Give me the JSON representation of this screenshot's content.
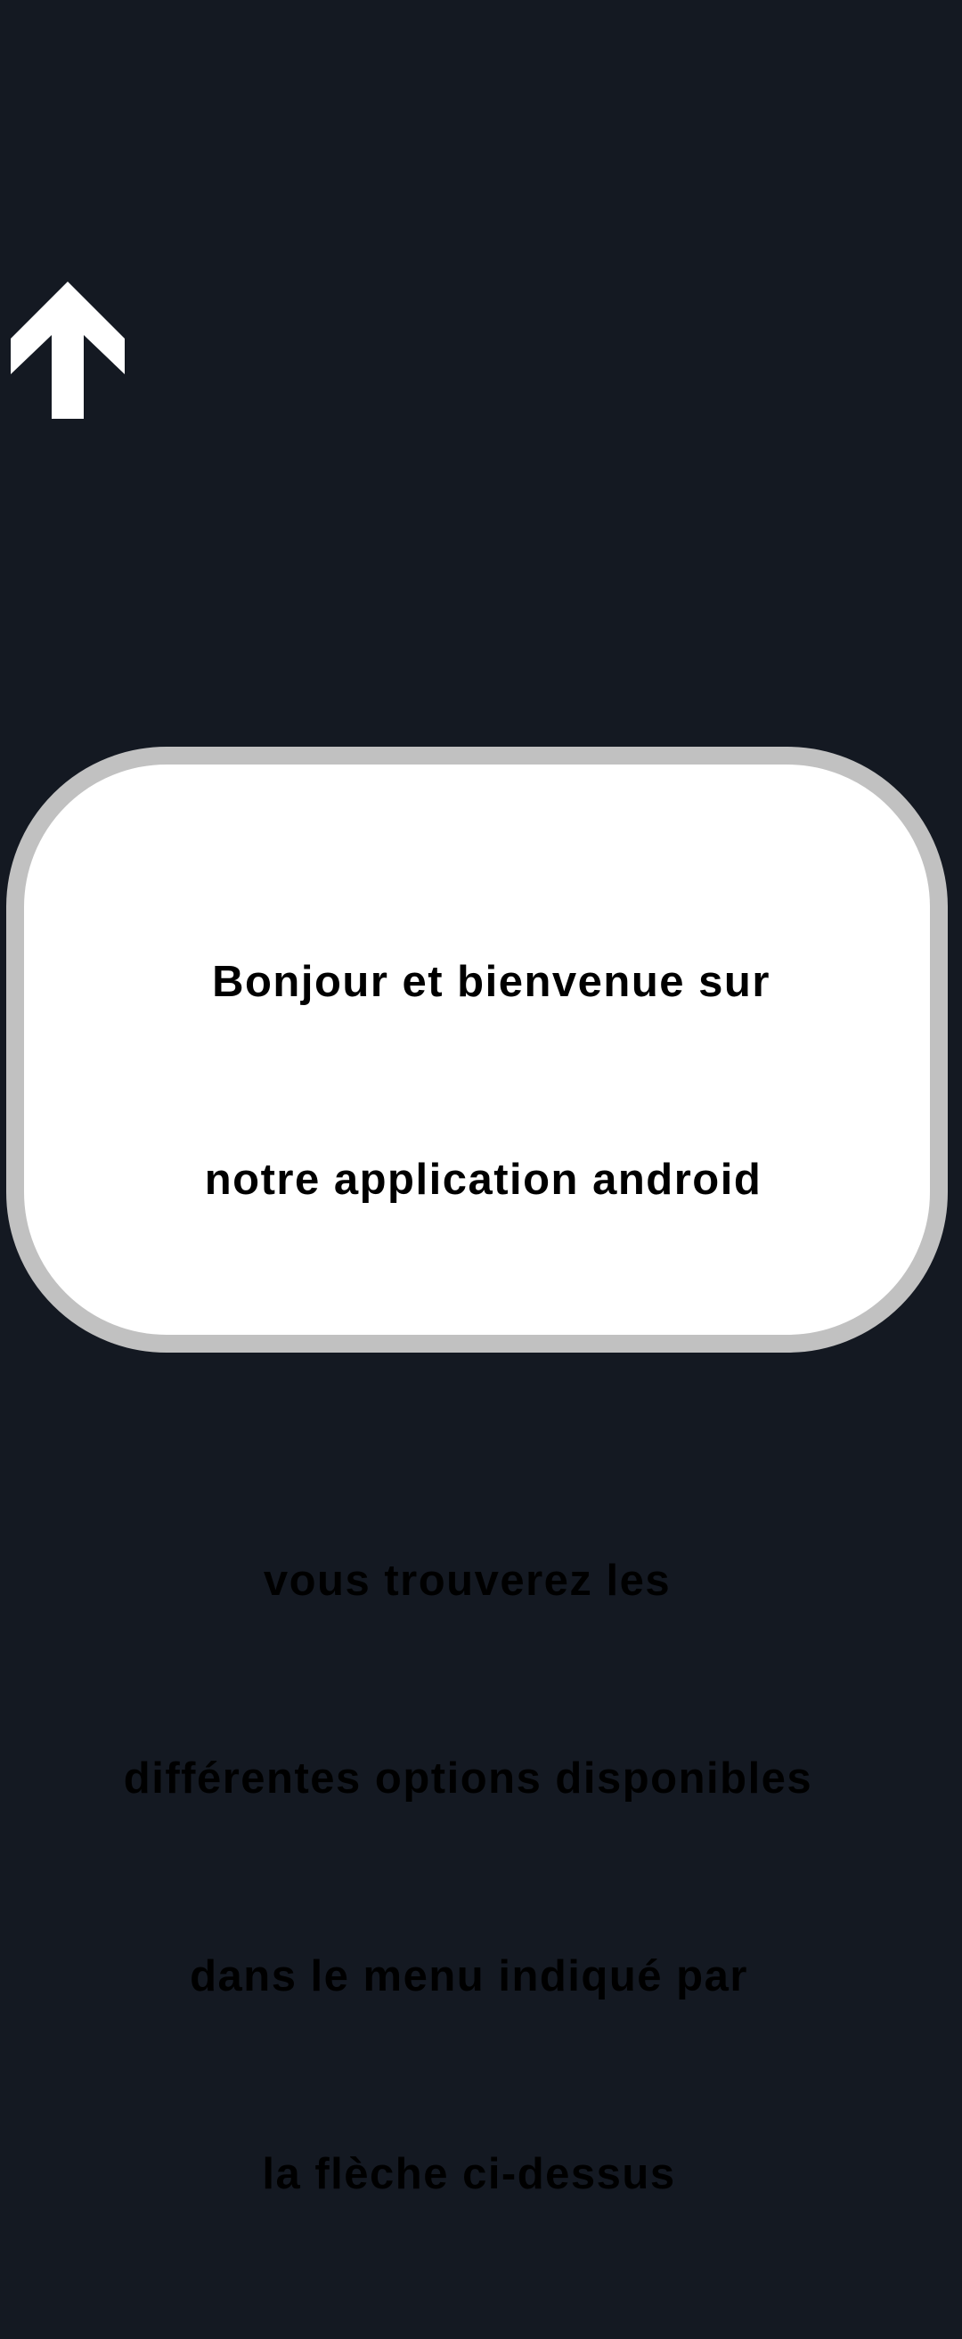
{
  "screen": {
    "background_color": "#141922"
  },
  "menu_arrow": {
    "icon": "arrow-up-icon",
    "color": "#ffffff"
  },
  "welcome_card": {
    "background_color": "#ffffff",
    "border_color": "#c1c1c1",
    "greeting": {
      "line1": "Bonjour et bienvenue sur",
      "line2": "notre application android"
    },
    "instructions": {
      "line1": "vous trouverez les",
      "line2": "différentes options disponibles",
      "line3": "dans le menu indiqué par",
      "line4": "la flèche ci-dessus"
    }
  }
}
